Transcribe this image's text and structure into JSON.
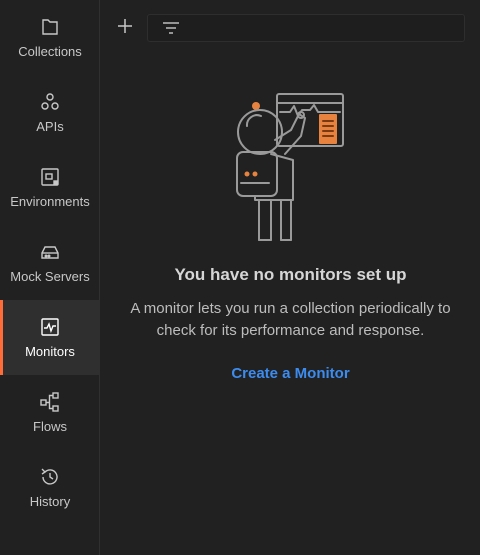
{
  "sidebar": {
    "items": [
      {
        "label": "Collections",
        "icon": "collections-icon",
        "active": false
      },
      {
        "label": "APIs",
        "icon": "apis-icon",
        "active": false
      },
      {
        "label": "Environments",
        "icon": "environments-icon",
        "active": false
      },
      {
        "label": "Mock Servers",
        "icon": "mock-servers-icon",
        "active": false
      },
      {
        "label": "Monitors",
        "icon": "monitors-icon",
        "active": true
      },
      {
        "label": "Flows",
        "icon": "flows-icon",
        "active": false
      },
      {
        "label": "History",
        "icon": "history-icon",
        "active": false
      }
    ]
  },
  "toolbar": {
    "add_icon": "plus-icon",
    "filter_icon": "filter-icon",
    "filter_placeholder": ""
  },
  "empty_state": {
    "illustration": "astronaut-monitor-illustration",
    "title": "You have no monitors set up",
    "description": "A monitor lets you run a collection periodically to check for its performance and response.",
    "cta_label": "Create a Monitor"
  },
  "colors": {
    "background": "#212121",
    "active_item_bg": "#2f2f2f",
    "accent": "#ff6c37",
    "link": "#3c8cf0"
  }
}
